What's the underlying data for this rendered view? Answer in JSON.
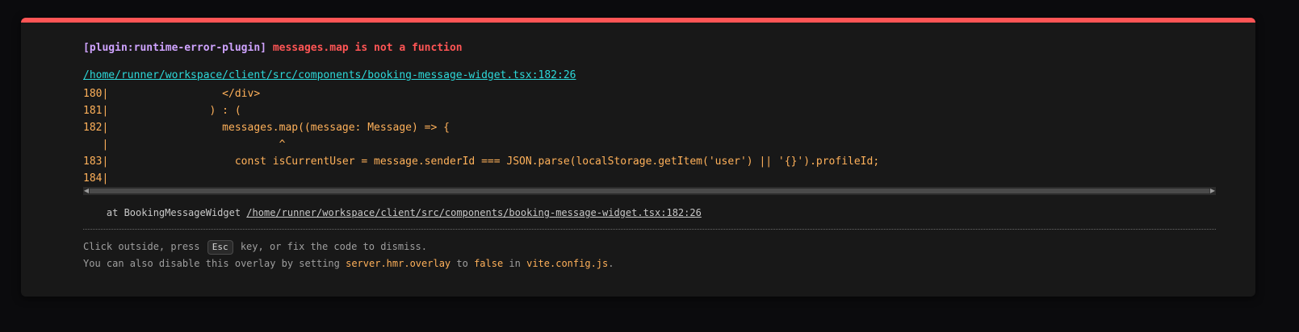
{
  "error": {
    "plugin": "[plugin:runtime-error-plugin]",
    "message": "messages.map is not a function",
    "file": "/home/runner/workspace/client/src/components/booking-message-widget.tsx:182:26"
  },
  "frame_lines": [
    "180|                  </div>",
    "181|                ) : (",
    "182|                  messages.map((message: Message) => {",
    "   |                           ^",
    "183|                    const isCurrentUser = message.senderId === JSON.parse(localStorage.getItem('user') || '{}').profileId;",
    "184|"
  ],
  "stack": {
    "prefix": "    at BookingMessageWidget ",
    "link": "/home/runner/workspace/client/src/components/booking-message-widget.tsx:182:26"
  },
  "tip": {
    "line1_before": "Click outside, press ",
    "key": "Esc",
    "line1_after": " key, or fix the code to dismiss.",
    "line2_before": "You can also disable this overlay by setting ",
    "setting": "server.hmr.overlay",
    "line2_mid": " to ",
    "value": "false",
    "line2_mid2": " in ",
    "config_file": "vite.config.js",
    "line2_end": "."
  },
  "colors": {
    "accent_bar": "#ff5555",
    "plugin_text": "#cfa3ff",
    "error_text": "#ff5555",
    "file_link": "#2dd9da",
    "code_text": "#ffb15a"
  }
}
